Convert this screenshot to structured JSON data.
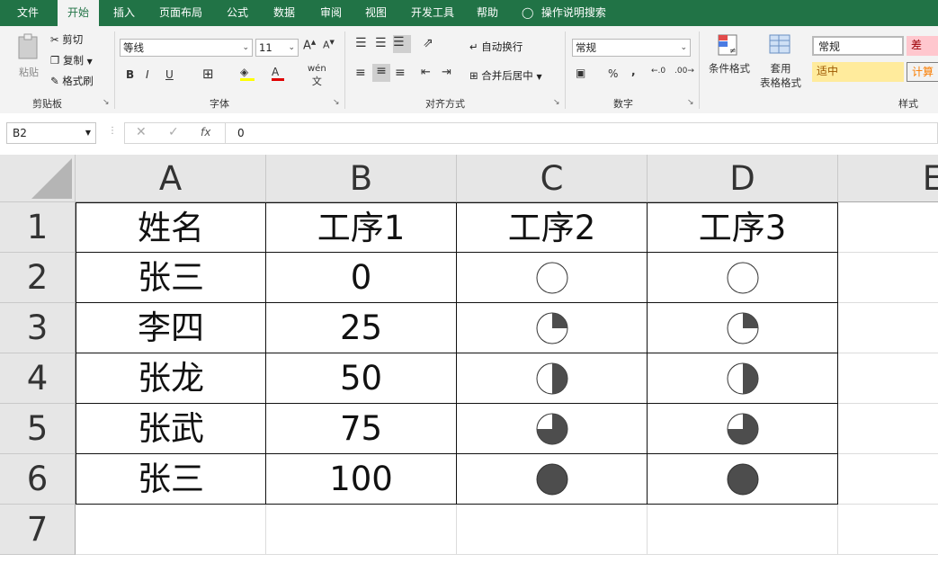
{
  "tabs": [
    "文件",
    "开始",
    "插入",
    "页面布局",
    "公式",
    "数据",
    "审阅",
    "视图",
    "开发工具",
    "帮助"
  ],
  "active_tab": "开始",
  "tell_me": "操作说明搜索",
  "clipboard": {
    "paste": "粘贴",
    "cut": "剪切",
    "copy": "复制",
    "format_painter": "格式刷",
    "group": "剪贴板"
  },
  "font": {
    "name": "等线",
    "size": "11",
    "bold": "B",
    "italic": "I",
    "underline": "U",
    "phonetic": "wén",
    "group": "字体"
  },
  "alignment": {
    "wrap": "自动换行",
    "merge": "合并后居中",
    "group": "对齐方式"
  },
  "number": {
    "format": "常规",
    "percent": "%",
    "comma": ",",
    "group": "数字"
  },
  "styles": {
    "conditional": "条件格式",
    "table_format_1": "套用",
    "table_format_2": "表格格式",
    "normal": "常规",
    "bad": "差",
    "neutral": "适中",
    "calc": "计算",
    "group": "样式"
  },
  "name_box": "B2",
  "formula_value": "0",
  "columns": [
    "A",
    "B",
    "C",
    "D",
    "E"
  ],
  "rows": [
    "1",
    "2",
    "3",
    "4",
    "5",
    "6",
    "7"
  ],
  "header_row": [
    "姓名",
    "工序1",
    "工序2",
    "工序3"
  ],
  "data_rows": [
    {
      "name": "张三",
      "value": "0",
      "c_fill": 0,
      "d_fill": 0
    },
    {
      "name": "李四",
      "value": "25",
      "c_fill": 0.25,
      "d_fill": 0.25
    },
    {
      "name": "张龙",
      "value": "50",
      "c_fill": 0.5,
      "d_fill": 0.5
    },
    {
      "name": "张武",
      "value": "75",
      "c_fill": 0.75,
      "d_fill": 0.75
    },
    {
      "name": "张三",
      "value": "100",
      "c_fill": 1,
      "d_fill": 1
    }
  ],
  "colors": {
    "excel_green": "#217346",
    "harvey_fill": "#4d4d4d",
    "neutral_bg": "#ffeb9c",
    "neutral_text": "#9c5700",
    "bad_bg": "#ffc7ce",
    "bad_text": "#9c0006"
  }
}
